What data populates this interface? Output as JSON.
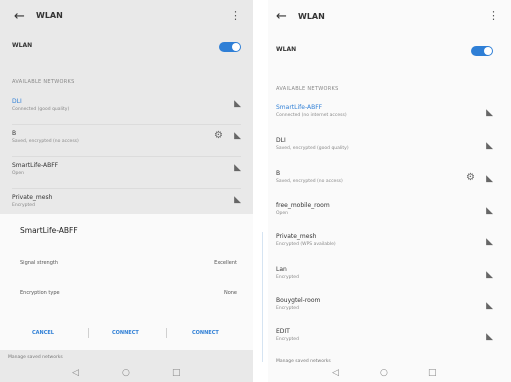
{
  "left": {
    "header": {
      "back_icon": "arrow-left-icon",
      "title": "WLAN",
      "more_icon": "vertical-dots-icon"
    },
    "wlan_label": "WLAN",
    "section_label": "AVAILABLE NETWORKS",
    "networks": [
      {
        "name": "DLI",
        "status": "Connected (good quality)"
      },
      {
        "name": "B",
        "status": "Saved, encrypted (no access)"
      },
      {
        "name": "SmartLife-ABFF",
        "status": "Open"
      },
      {
        "name": "Private_mesh",
        "status": "Encrypted"
      }
    ],
    "dialog": {
      "title": "SmartLife-ABFF",
      "rows": [
        {
          "label": "Signal strength",
          "value": "Excellent"
        },
        {
          "label": "Encryption type",
          "value": "None"
        }
      ],
      "buttons": [
        "CANCEL",
        "CONNECT",
        "CONNECT"
      ]
    },
    "bottom_text": "Manage saved networks"
  },
  "right": {
    "header": {
      "back_icon": "arrow-left-icon",
      "title": "WLAN",
      "more_icon": "vertical-dots-icon"
    },
    "wlan_label": "WLAN",
    "section_label": "AVAILABLE NETWORKS",
    "networks": [
      {
        "name": "SmartLife-ABFF",
        "status": "Connected (no internet access)",
        "connected": true
      },
      {
        "name": "DLI",
        "status": "Saved, encrypted (good quality)"
      },
      {
        "name": "B",
        "status": "Saved, encrypted (no access)"
      },
      {
        "name": "free_mobile_room",
        "status": "Open"
      },
      {
        "name": "Private_mesh",
        "status": "Encrypted (WPS available)"
      },
      {
        "name": "Lan",
        "status": "Encrypted"
      },
      {
        "name": "Bouygtel-room",
        "status": "Encrypted"
      },
      {
        "name": "EDIT",
        "status": "Encrypted"
      }
    ],
    "bottom_text": "Manage saved networks"
  },
  "nav": {
    "back": "◁",
    "home": "○",
    "recent": "□"
  },
  "colors": {
    "accent": "#2f7fd6",
    "toggle_on": "#2f7fd6"
  }
}
